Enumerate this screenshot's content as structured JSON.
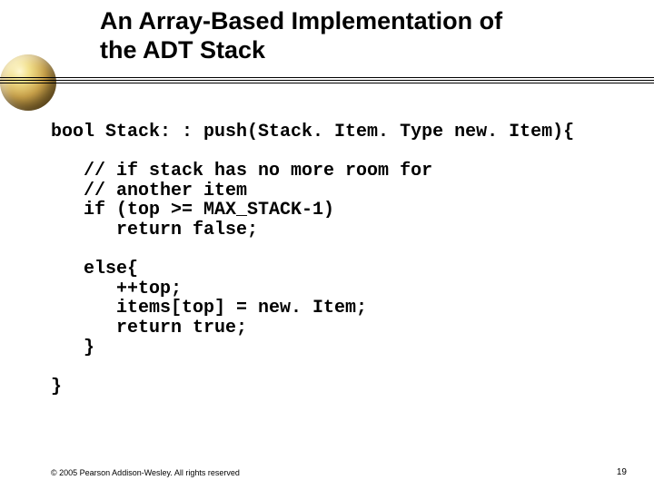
{
  "title_line1": "An Array-Based Implementation of",
  "title_line2": "the ADT Stack",
  "code_lines": [
    "bool Stack: : push(Stack. Item. Type new. Item){",
    "",
    "   // if stack has no more room for",
    "   // another item",
    "   if (top >= MAX_STACK-1)",
    "      return false;",
    "",
    "   else{",
    "      ++top;",
    "      items[top] = new. Item;",
    "      return true;",
    "   }",
    "",
    "}"
  ],
  "footer_left": "© 2005 Pearson Addison-Wesley. All rights reserved",
  "footer_right": "19"
}
